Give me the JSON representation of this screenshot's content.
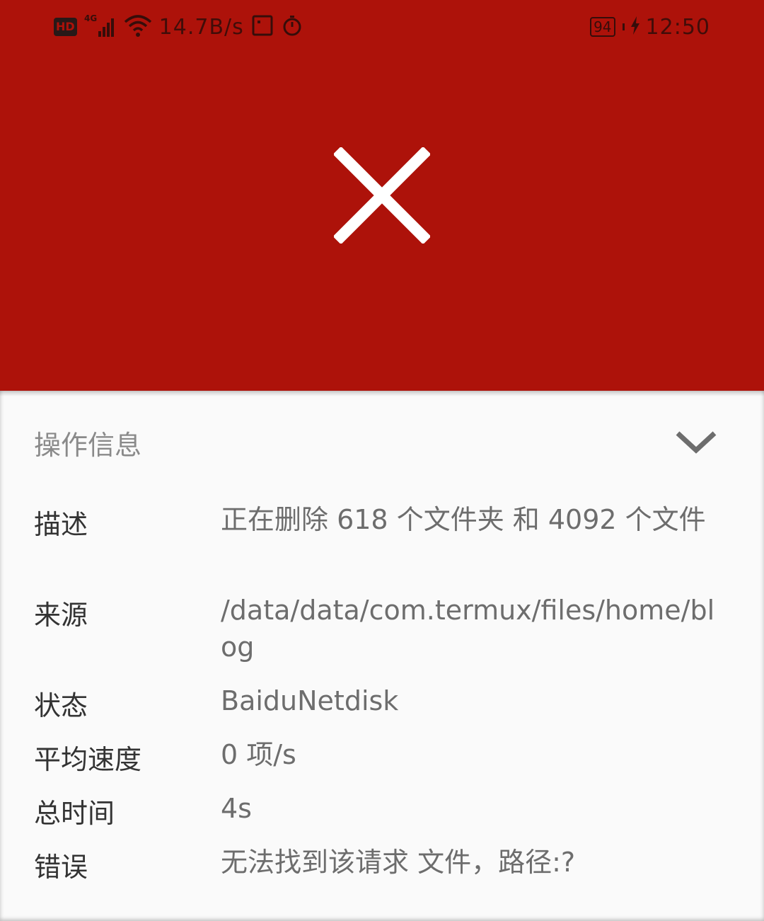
{
  "status_bar": {
    "hd_badge": "HD",
    "network_type": "4G",
    "net_speed": "14.7B/s",
    "battery_level": "94",
    "time": "12:50",
    "icons": [
      "signal-icon",
      "wifi-icon",
      "notification-icon",
      "timer-icon",
      "charging-icon"
    ]
  },
  "header": {
    "color": "#ad120a",
    "status_icon": "close-icon"
  },
  "panel": {
    "title": "操作信息",
    "collapse_icon": "chevron-down-icon",
    "rows": [
      {
        "label": "描述",
        "value": "正在删除 618 个文件夹 和 4092 个文件"
      },
      {
        "label": "来源",
        "value": "/data/data/com.termux/files/home/blog"
      },
      {
        "label": "状态",
        "value": "BaiduNetdisk"
      },
      {
        "label": "平均速度",
        "value": "0 项/s"
      },
      {
        "label": "总时间",
        "value": "4s"
      },
      {
        "label": "错误",
        "value": "无法找到该请求 文件，路径:?"
      }
    ]
  }
}
